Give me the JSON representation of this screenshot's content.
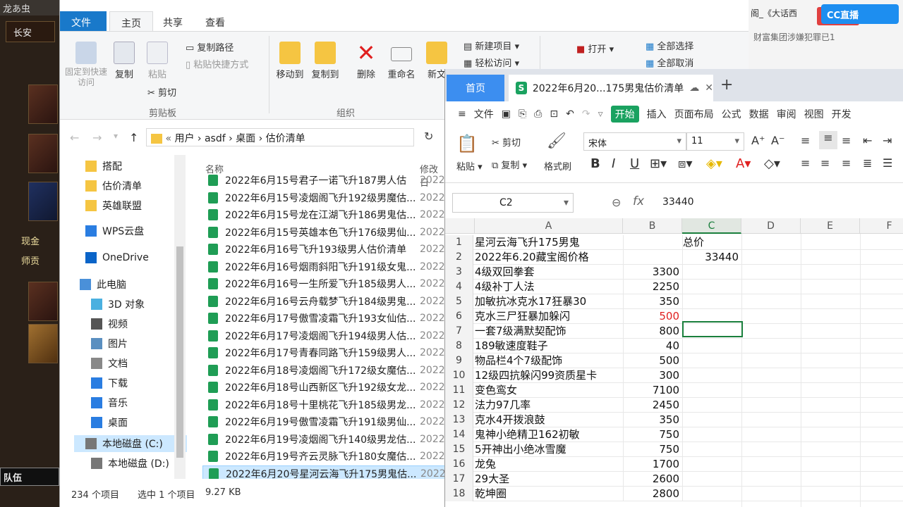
{
  "game": {
    "top_text": "龙あ虫",
    "city": "长安",
    "stat1": "现金",
    "stat2": "师贡",
    "team": "队伍"
  },
  "browser": {
    "tab_title": "阁_《大话西",
    "news_text": "财富集团涉嫌犯罪已1",
    "cc_label": "CC直播"
  },
  "explorer": {
    "tabs": {
      "file": "文件",
      "home": "主页",
      "share": "共享",
      "view": "查看"
    },
    "ribbon": {
      "pin": "固定到快速访问",
      "copy": "复制",
      "paste": "粘贴",
      "copy_path": "复制路径",
      "paste_shortcut": "粘贴快捷方式",
      "cut": "剪切",
      "clipboard_group": "剪贴板",
      "move_to": "移动到",
      "copy_to": "复制到",
      "delete": "删除",
      "rename": "重命名",
      "new_folder": "新文",
      "organize_group": "组织",
      "new_item": "新建项目",
      "easy_access": "轻松访问",
      "open": "打开",
      "select_all": "全部选择",
      "deselect": "全部取消"
    },
    "breadcrumb": [
      "用户",
      "asdf",
      "桌面",
      "估价清单"
    ],
    "nav_items": [
      {
        "label": "搭配",
        "icon": "folder-icon"
      },
      {
        "label": "估价清单",
        "icon": "folder-icon"
      },
      {
        "label": "英雄联盟",
        "icon": "folder-icon"
      },
      {
        "label": "WPS云盘",
        "icon": "cloud-icon"
      },
      {
        "label": "OneDrive",
        "icon": "onedrive-icon"
      },
      {
        "label": "此电脑",
        "icon": "computer-icon"
      },
      {
        "label": "3D 对象",
        "icon": "cube-icon"
      },
      {
        "label": "视频",
        "icon": "video-icon"
      },
      {
        "label": "图片",
        "icon": "picture-icon"
      },
      {
        "label": "文档",
        "icon": "document-icon"
      },
      {
        "label": "下载",
        "icon": "download-icon"
      },
      {
        "label": "音乐",
        "icon": "music-icon"
      },
      {
        "label": "桌面",
        "icon": "desktop-icon"
      },
      {
        "label": "本地磁盘 (C:)",
        "icon": "drive-icon"
      },
      {
        "label": "本地磁盘 (D:)",
        "icon": "drive-icon"
      }
    ],
    "columns": {
      "name": "名称",
      "modified": "修改日"
    },
    "files": [
      "2022年6月15号君子一诺飞升187男人估",
      "2022年6月15号凌烟阁飞升192级男魔估...",
      "2022年6月15号龙在江湖飞升186男鬼估...",
      "2022年6月15号英雄本色飞升176级男仙...",
      "2022年6月16号飞升193级男人估价清单",
      "2022年6月16号烟雨斜阳飞升191级女鬼...",
      "2022年6月16号一生所爱飞升185级男人...",
      "2022年6月16号云舟载梦飞升184级男鬼...",
      "2022年6月17号傲雪凌霜飞升193女仙估...",
      "2022年6月17号凌烟阁飞升194级男人估...",
      "2022年6月17号青春同路飞升159级男人...",
      "2022年6月18号凌烟阁飞升172级女魔估...",
      "2022年6月18号山西新区飞升192级女龙...",
      "2022年6月18号十里桃花飞升185级男龙...",
      "2022年6月19号傲雪凌霜飞升191级男仙...",
      "2022年6月19号凌烟阁飞升140级男龙估...",
      "2022年6月19号齐云灵脉飞升180女魔估...",
      "2022年6月20号星河云海飞升175男鬼估..."
    ],
    "file_date": "2022/",
    "status": {
      "count": "234 个项目",
      "selected": "选中 1 个项目",
      "size": "9.27 KB"
    }
  },
  "wps": {
    "home_tab": "首页",
    "doc_tab": "2022年6月20...175男鬼估价清单",
    "menu": [
      "文件",
      "开始",
      "插入",
      "页面布局",
      "公式",
      "数据",
      "审阅",
      "视图",
      "开发"
    ],
    "toolbar": {
      "paste": "粘贴",
      "cut": "剪切",
      "copy": "复制",
      "format_painter": "格式刷",
      "font_name": "宋体",
      "font_size": "11"
    },
    "name_box": "C2",
    "fx_value": "33440",
    "columns": [
      "A",
      "B",
      "C",
      "D",
      "E",
      "F"
    ],
    "rows": [
      {
        "n": "1",
        "a": "星河云海飞升175男鬼",
        "b": "",
        "c": "总价",
        "red": false
      },
      {
        "n": "2",
        "a": "2022年6.20藏宝阁价格",
        "b": "",
        "c": "33440",
        "red": false
      },
      {
        "n": "3",
        "a": "4级双回拳套",
        "b": "3300",
        "c": "",
        "red": false
      },
      {
        "n": "4",
        "a": "4级补丁人法",
        "b": "2250",
        "c": "",
        "red": false
      },
      {
        "n": "5",
        "a": "加敏抗冰克水17狂暴30",
        "b": "350",
        "c": "",
        "red": false
      },
      {
        "n": "6",
        "a": "克水三尸狂暴加躲闪",
        "b": "500",
        "c": "",
        "red": true
      },
      {
        "n": "7",
        "a": "一套7级满默契配饰",
        "b": "800",
        "c": "",
        "red": false
      },
      {
        "n": "8",
        "a": "189敏速度鞋子",
        "b": "40",
        "c": "",
        "red": false
      },
      {
        "n": "9",
        "a": "物品栏4个7级配饰",
        "b": "500",
        "c": "",
        "red": false
      },
      {
        "n": "10",
        "a": "12级四抗躲闪99资质星卡",
        "b": "300",
        "c": "",
        "red": false
      },
      {
        "n": "11",
        "a": "变色鸾女",
        "b": "7100",
        "c": "",
        "red": false
      },
      {
        "n": "12",
        "a": "法力97几率",
        "b": "2450",
        "c": "",
        "red": false
      },
      {
        "n": "13",
        "a": "克水4开拨浪鼓",
        "b": "350",
        "c": "",
        "red": false
      },
      {
        "n": "14",
        "a": "鬼神小绝精卫162初敏",
        "b": "750",
        "c": "",
        "red": false
      },
      {
        "n": "15",
        "a": "5开神出小绝冰雪魔",
        "b": "750",
        "c": "",
        "red": false
      },
      {
        "n": "16",
        "a": "龙兔",
        "b": "1700",
        "c": "",
        "red": false
      },
      {
        "n": "17",
        "a": "29大圣",
        "b": "2600",
        "c": "",
        "red": false
      },
      {
        "n": "18",
        "a": "乾坤圈",
        "b": "2800",
        "c": "",
        "red": false
      }
    ]
  }
}
